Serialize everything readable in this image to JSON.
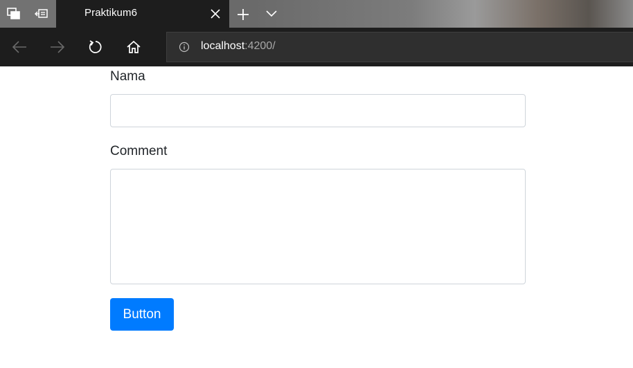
{
  "browser": {
    "tab": {
      "title": "Praktikum6"
    },
    "address_bar": {
      "host": "localhost",
      "port_path": ":4200/"
    },
    "icons": {
      "tab_actions": "tab-preview-icon",
      "set_aside": "set-aside-tabs-icon",
      "close_tab": "close-icon",
      "new_tab": "plus-icon",
      "tab_list": "chevron-down-icon",
      "back": "back-arrow-icon",
      "forward": "forward-arrow-icon",
      "refresh": "refresh-icon",
      "home": "home-icon",
      "site_info": "info-icon"
    }
  },
  "form": {
    "nama_label": "Nama",
    "nama_value": "",
    "comment_label": "Comment",
    "comment_value": "",
    "button_label": "Button"
  },
  "colors": {
    "primary_button": "#007bff",
    "browser_chrome": "#1d1d1d",
    "input_border": "#ced4da"
  }
}
